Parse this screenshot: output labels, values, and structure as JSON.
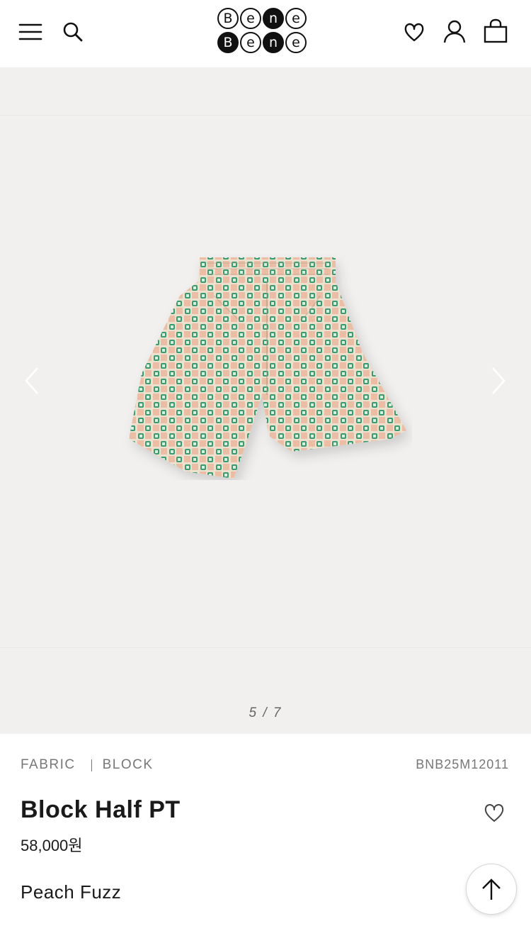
{
  "header": {
    "logo_row1": [
      "B",
      "e",
      "n",
      "e"
    ],
    "logo_row2": [
      "B",
      "e",
      "n",
      "e"
    ],
    "icons": [
      "menu-icon",
      "search-icon",
      "wishlist-icon",
      "account-icon",
      "cart-icon"
    ]
  },
  "gallery": {
    "current": "5",
    "separator": "/",
    "total": "7",
    "icons": [
      "chevron-left-icon",
      "chevron-right-icon"
    ],
    "pattern_colors": {
      "base": "#e9dcc9",
      "green": "#3c9a6e",
      "peach": "#e7a98a"
    }
  },
  "product": {
    "category_1": "FABRIC",
    "category_2": "BLOCK",
    "sku": "BNB25M12011",
    "name": "Block Half PT",
    "price": "58,000원",
    "color": "Peach Fuzz"
  }
}
